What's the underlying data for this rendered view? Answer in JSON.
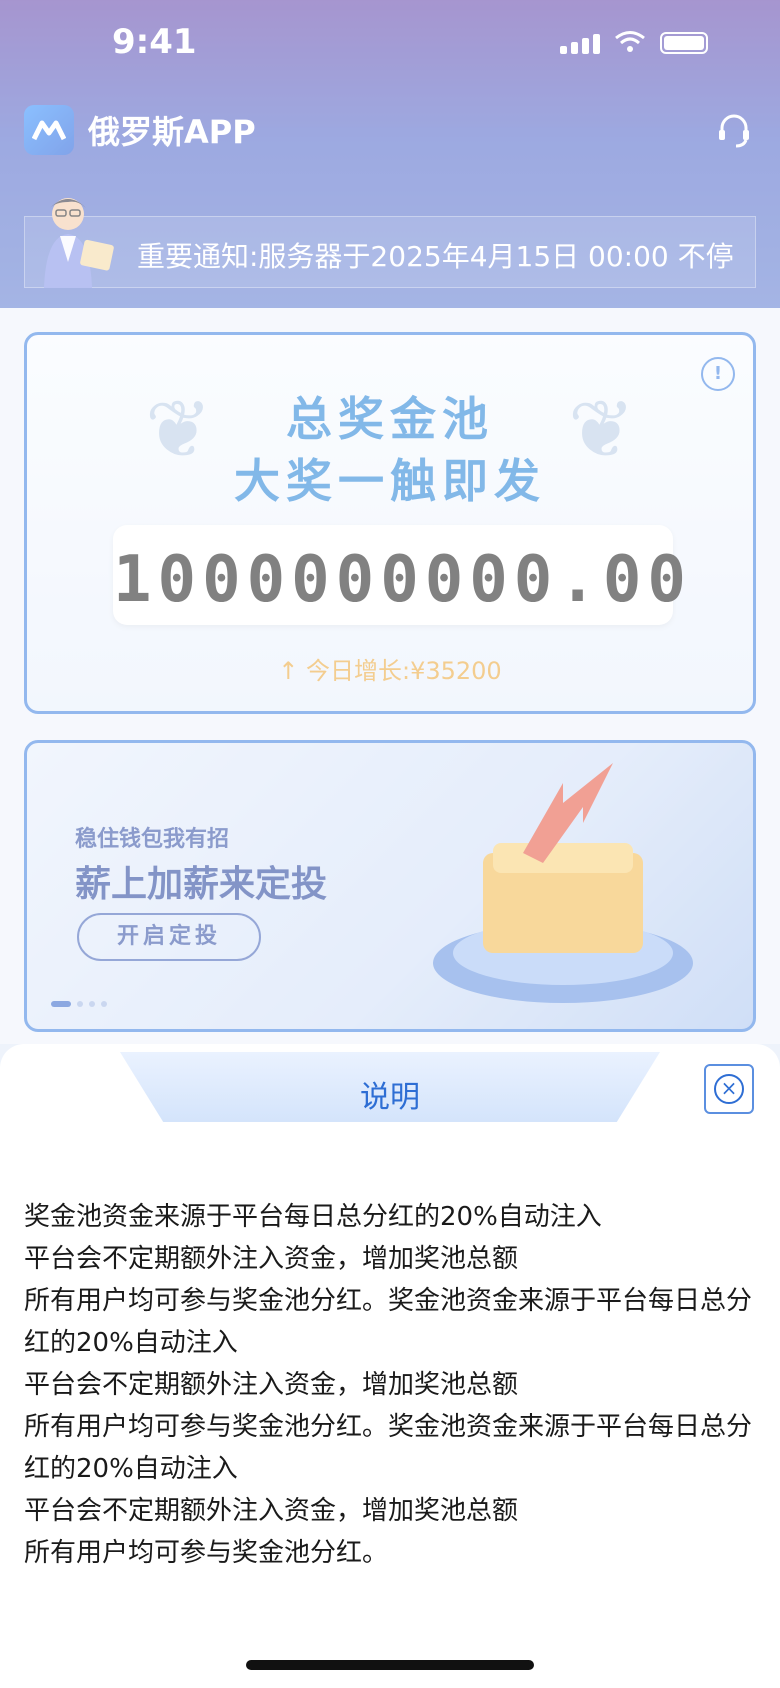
{
  "status_bar": {
    "time": "9:41"
  },
  "app": {
    "title": "俄罗斯APP"
  },
  "notice": {
    "text": "重要通知:服务器于2025年4月15日 00:00 不停"
  },
  "pool": {
    "title_line1": "总奖金池",
    "title_line2": "大奖一触即发",
    "amount": "1000000000.00",
    "growth": "↑   今日增长:¥35200"
  },
  "banner": {
    "subtitle": "稳住钱包我有招",
    "title": "薪上加薪来定投",
    "button_label": "开启定投",
    "page_count": 4,
    "active_page": 0
  },
  "sheet": {
    "title": "说明",
    "lines": [
      "奖金池资金来源于平台每日总分红的20%自动注入",
      "平台会不定期额外注入资金，增加奖池总额",
      "所有用户均可参与奖金池分红。奖金池资金来源于平台每日总分红的20%自动注入",
      "平台会不定期额外注入资金，增加奖池总额",
      "所有用户均可参与奖金池分红。奖金池资金来源于平台每日总分红的20%自动注入",
      "平台会不定期额外注入资金，增加奖池总额",
      "所有用户均可参与奖金池分红。"
    ]
  }
}
